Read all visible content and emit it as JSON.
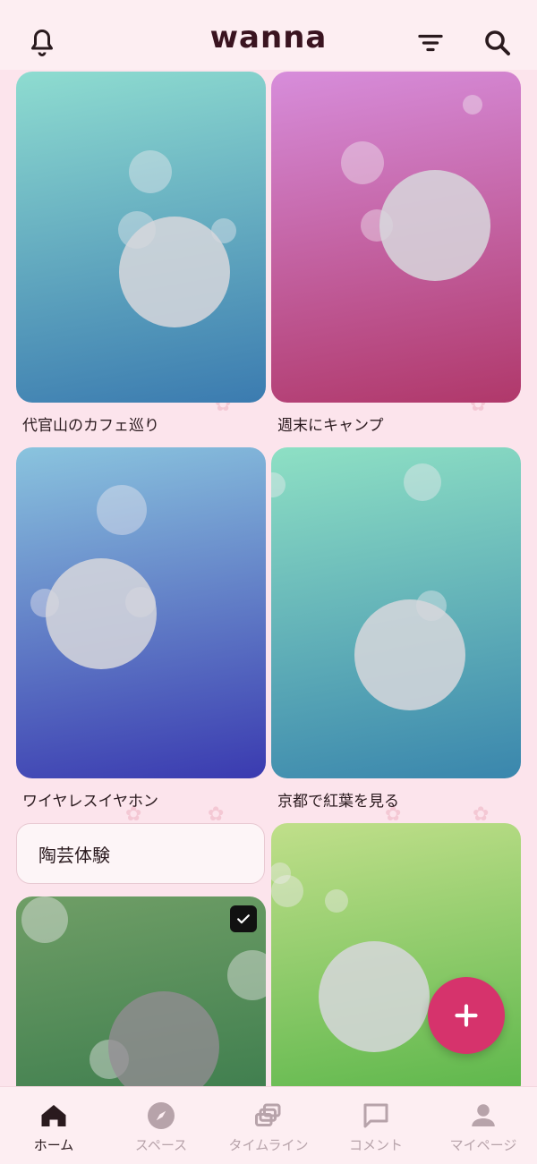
{
  "app": {
    "logo": "wanna"
  },
  "header": {
    "icons": [
      "bell-icon",
      "filter-icon",
      "search-icon"
    ]
  },
  "cards": [
    {
      "caption": "代官山のカフェ巡り",
      "gradient": [
        "#8edcd0",
        "#3b7bb0"
      ]
    },
    {
      "caption": "週末にキャンプ",
      "gradient": [
        "#d78ddb",
        "#b0386a"
      ]
    },
    {
      "caption": "ワイヤレスイヤホン",
      "gradient": [
        "#8ac4de",
        "#3a3ab0"
      ]
    },
    {
      "caption": "京都で紅葉を見る",
      "gradient": [
        "#8ee0c4",
        "#3a86ad"
      ]
    },
    {
      "caption": "",
      "gradient": [
        "#6f9e66",
        "#3c7c4d"
      ],
      "checked": true
    },
    {
      "caption": "",
      "gradient": [
        "#c0df8a",
        "#5bb64a"
      ]
    }
  ],
  "pill": {
    "label": "陶芸体験"
  },
  "fab": {
    "icon": "plus-icon",
    "color": "#d6336c"
  },
  "bottom_nav": [
    {
      "label": "ホーム",
      "icon": "home-icon",
      "active": true
    },
    {
      "label": "スペース",
      "icon": "compass-icon",
      "active": false
    },
    {
      "label": "タイムライン",
      "icon": "timeline-icon",
      "active": false
    },
    {
      "label": "コメント",
      "icon": "comment-icon",
      "active": false
    },
    {
      "label": "マイページ",
      "icon": "person-icon",
      "active": false
    }
  ],
  "colors": {
    "background": "#fce4ec",
    "accent": "#d6336c",
    "nav_inactive": "#b7a3aa"
  }
}
